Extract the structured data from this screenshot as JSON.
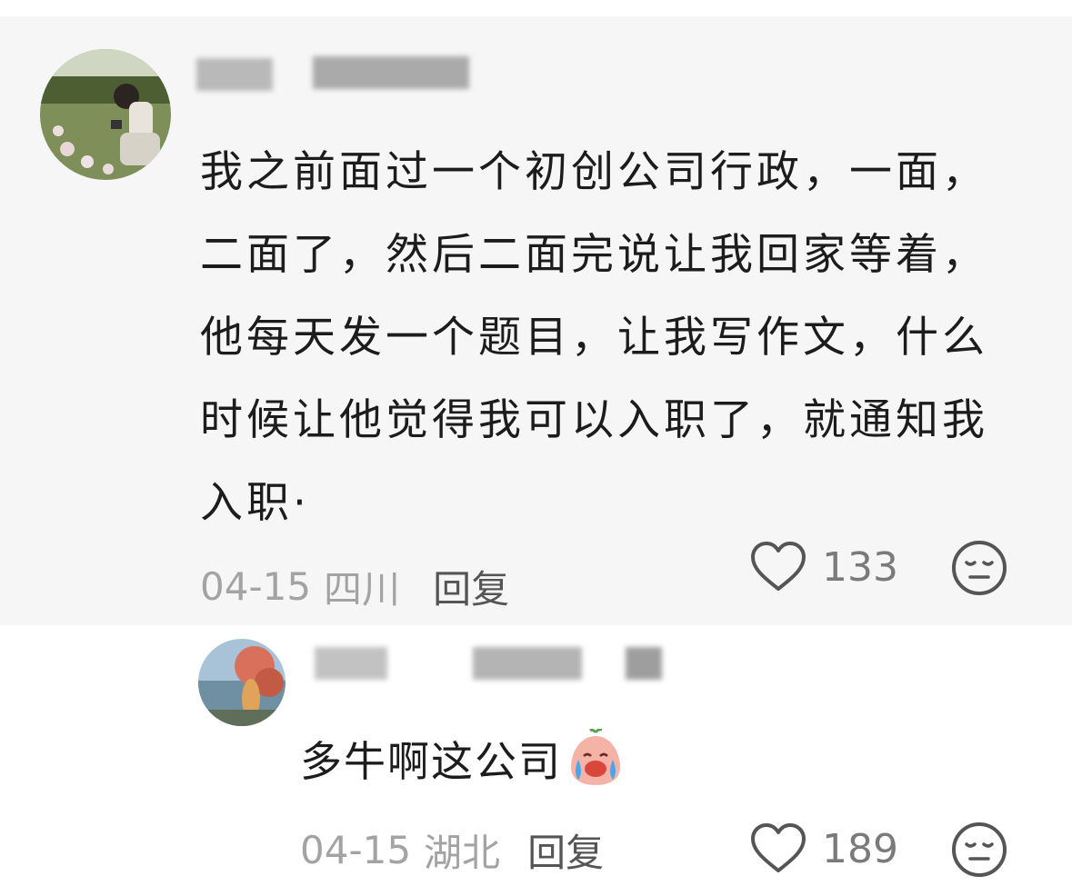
{
  "main_comment": {
    "text": "我之前面过一个初创公司行政，一面，二面了，然后二面完说让我回家等着，他每天发一个题目，让我写作文，什么时候让他觉得我可以入职了，就通知我入职·",
    "date": "04-15",
    "location": "四川",
    "reply_label": "回复",
    "likes": "133",
    "icon_like": "heart-outline-icon",
    "icon_reaction": "neutral-face-icon"
  },
  "reply_comment": {
    "text": "多牛啊这公司",
    "emoji": "crying-laughing-emoji",
    "date": "04-15",
    "location": "湖北",
    "reply_label": "回复",
    "likes": "189",
    "icon_like": "heart-outline-icon",
    "icon_reaction": "neutral-face-icon"
  },
  "colors": {
    "background": "#ffffff",
    "comment_bg": "#f6f6f6",
    "text": "#1c1c1c",
    "meta": "#a3a3a3",
    "reply_link": "#555555"
  }
}
